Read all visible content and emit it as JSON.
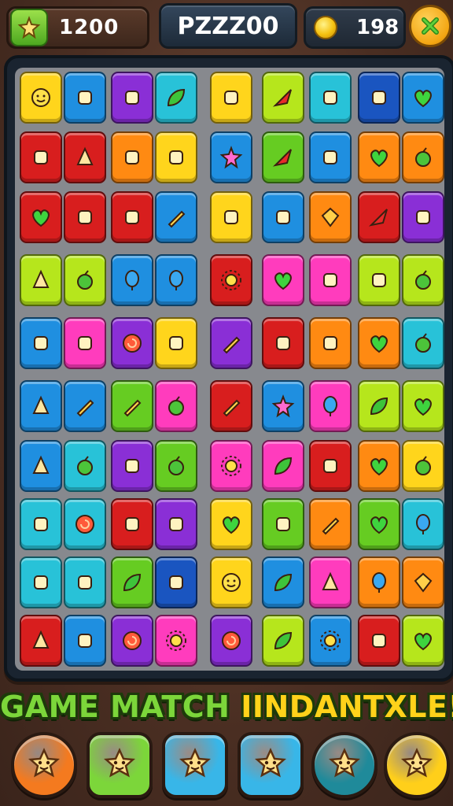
{
  "header": {
    "left_counter": "1200",
    "title": "PZZZ00",
    "coin_counter": "198",
    "left_badge_icon": "star-leaf-icon",
    "coin_icon": "gold-coin-icon",
    "close_icon": "close-x-icon"
  },
  "banner": {
    "part1": "GAME MATCH ",
    "part2": "IINDANTXLE!"
  },
  "bottom_buttons": [
    {
      "icon": "orange-star-creature-icon",
      "color": "#f47a1f"
    },
    {
      "icon": "white-blob-creature-icon",
      "color": "#7cd63a"
    },
    {
      "icon": "yellow-star-creature-icon",
      "color": "#38b6e8"
    },
    {
      "icon": "yellow-star-creature-icon",
      "color": "#38b6e8"
    },
    {
      "icon": "orange-flame-creature-icon",
      "color": "#1f8a9a"
    },
    {
      "icon": "brown-owl-creature-icon",
      "color": "#ffcf1a"
    }
  ],
  "colors": {
    "yellow": "#ffd51c",
    "blue": "#1f8fe0",
    "purple": "#8a2fd6",
    "cyan": "#28c2d8",
    "green": "#66cc22",
    "lime": "#b6e61c",
    "red": "#d81e1e",
    "orange": "#ff8a12",
    "pink": "#ff3cbd",
    "navy": "#1a55c0"
  },
  "board_rows": [
    [
      "yellow:smiley-icon",
      "blue:sword-icon",
      "purple:card-icon",
      "cyan:leaf-icon",
      "yellow:cake-icon",
      "lime:arrow-icon",
      "cyan:feather-icon",
      "navy:horn-icon",
      "blue:heart-icon"
    ],
    [
      "red:scroll-icon",
      "red:bell-icon",
      "orange:rose-icon",
      "yellow:rocket-icon",
      "blue:star-icon",
      "green:arrow-icon",
      "blue:creature-icon",
      "orange:heart-icon",
      "orange:apple-icon"
    ],
    [
      "red:heart-icon",
      "red:puzzle-icon",
      "red:shell-icon",
      "blue:pencil-icon",
      "yellow:box-icon",
      "blue:snowman-icon",
      "orange:gem-icon",
      "red:triangle-icon",
      "purple:carrot-icon"
    ],
    [
      "lime:cone-icon",
      "lime:apple-icon",
      "blue:balloon-icon",
      "blue:pear-icon",
      "red:sun-icon",
      "pink:heart-icon",
      "pink:eggplant-icon",
      "lime:jar-icon",
      "lime:apple-icon"
    ],
    [
      "blue:ghost-icon",
      "pink:flag-icon",
      "purple:spiral-icon",
      "yellow:lollipop-icon",
      "purple:pencil-icon",
      "red:eggplant-icon",
      "orange:hand-icon",
      "orange:heart-icon",
      "cyan:apple-icon"
    ],
    [
      "blue:cone-icon",
      "blue:brush-icon",
      "green:brush-icon",
      "pink:apple-icon",
      "red:pencil-icon",
      "blue:star-icon",
      "pink:drop-icon",
      "lime:leaf-icon",
      "lime:heart-icon"
    ],
    [
      "blue:bell-icon",
      "cyan:apple-icon",
      "purple:pin-icon",
      "green:apple-icon",
      "pink:sun-icon",
      "pink:leaf-icon",
      "red:pepper-icon",
      "orange:heart-icon",
      "yellow:apple-icon"
    ],
    [
      "cyan:bird-icon",
      "cyan:spiral-icon",
      "red:flower-icon",
      "purple:wrench-icon",
      "yellow:heart-icon",
      "green:jar-icon",
      "orange:pencil-icon",
      "green:heart-icon",
      "cyan:balloon-icon"
    ],
    [
      "cyan:scroll-icon",
      "cyan:creature-icon",
      "green:leaf-icon",
      "navy:syringe-icon",
      "yellow:smiley-icon",
      "blue:leaf-icon",
      "pink:cone-icon",
      "orange:balloon-icon",
      "orange:gem-icon"
    ],
    [
      "red:bell-icon",
      "blue:splash-icon",
      "purple:spiral-icon",
      "pink:sun-icon",
      "purple:spiral-icon",
      "lime:leaf-icon",
      "blue:sun-icon",
      "red:scroll-icon",
      "lime:heart-icon"
    ]
  ]
}
